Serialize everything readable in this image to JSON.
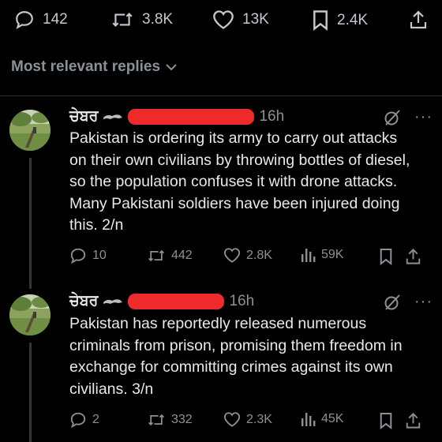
{
  "top_actions": {
    "replies": "142",
    "reposts": "3.8K",
    "likes": "13K",
    "bookmarks": "2.4K"
  },
  "sort": {
    "label": "Most relevant replies"
  },
  "tweets": [
    {
      "name": "ਚੇਬਰ",
      "time": "16h",
      "text": "Pakistan is ordering its army to carry out attacks on their own civilians by throwing bottles of diesel, so the population confuses it with drone attacks. Many Pakistani soldiers have been injured doing this. 2/n",
      "replies": "10",
      "reposts": "442",
      "likes": "2.8K",
      "views": "59K"
    },
    {
      "name": "ਚੇਬਰ",
      "time": "16h",
      "text": "Pakistan has reportedly released numerous criminals from prison, promising them freedom in exchange for committing crimes against its own civilians. 3/n",
      "replies": "2",
      "reposts": "332",
      "likes": "2.3K",
      "views": "45K"
    }
  ]
}
